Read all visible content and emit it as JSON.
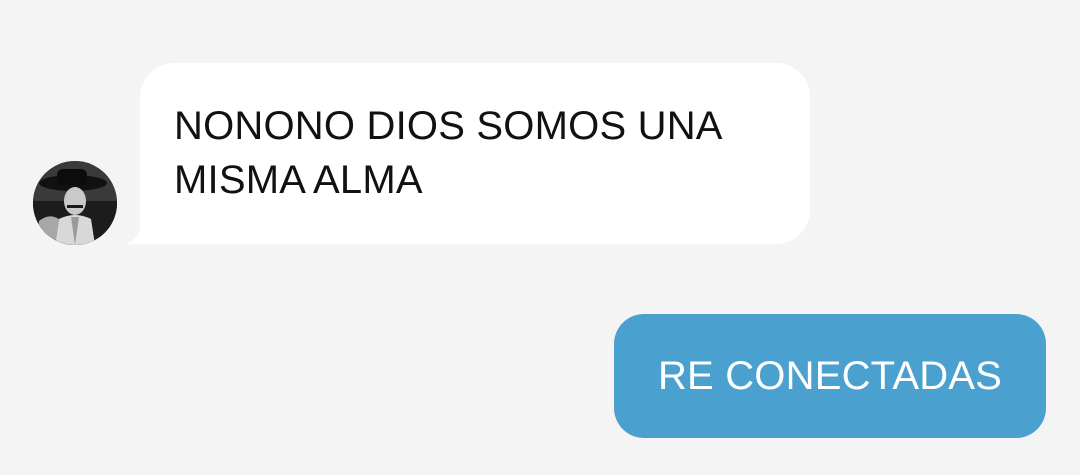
{
  "conversation": {
    "messages": [
      {
        "direction": "incoming",
        "text": "NONONO DIOS SOMOS UNA MISMA ALMA",
        "avatar_icon": "contact-avatar"
      },
      {
        "direction": "outgoing",
        "text": "RE CONECTADAS"
      }
    ]
  },
  "colors": {
    "background": "#f4f4f4",
    "incoming_bubble": "#ffffff",
    "outgoing_bubble": "#4aa0cf",
    "incoming_text": "#111111",
    "outgoing_text": "#ffffff"
  }
}
